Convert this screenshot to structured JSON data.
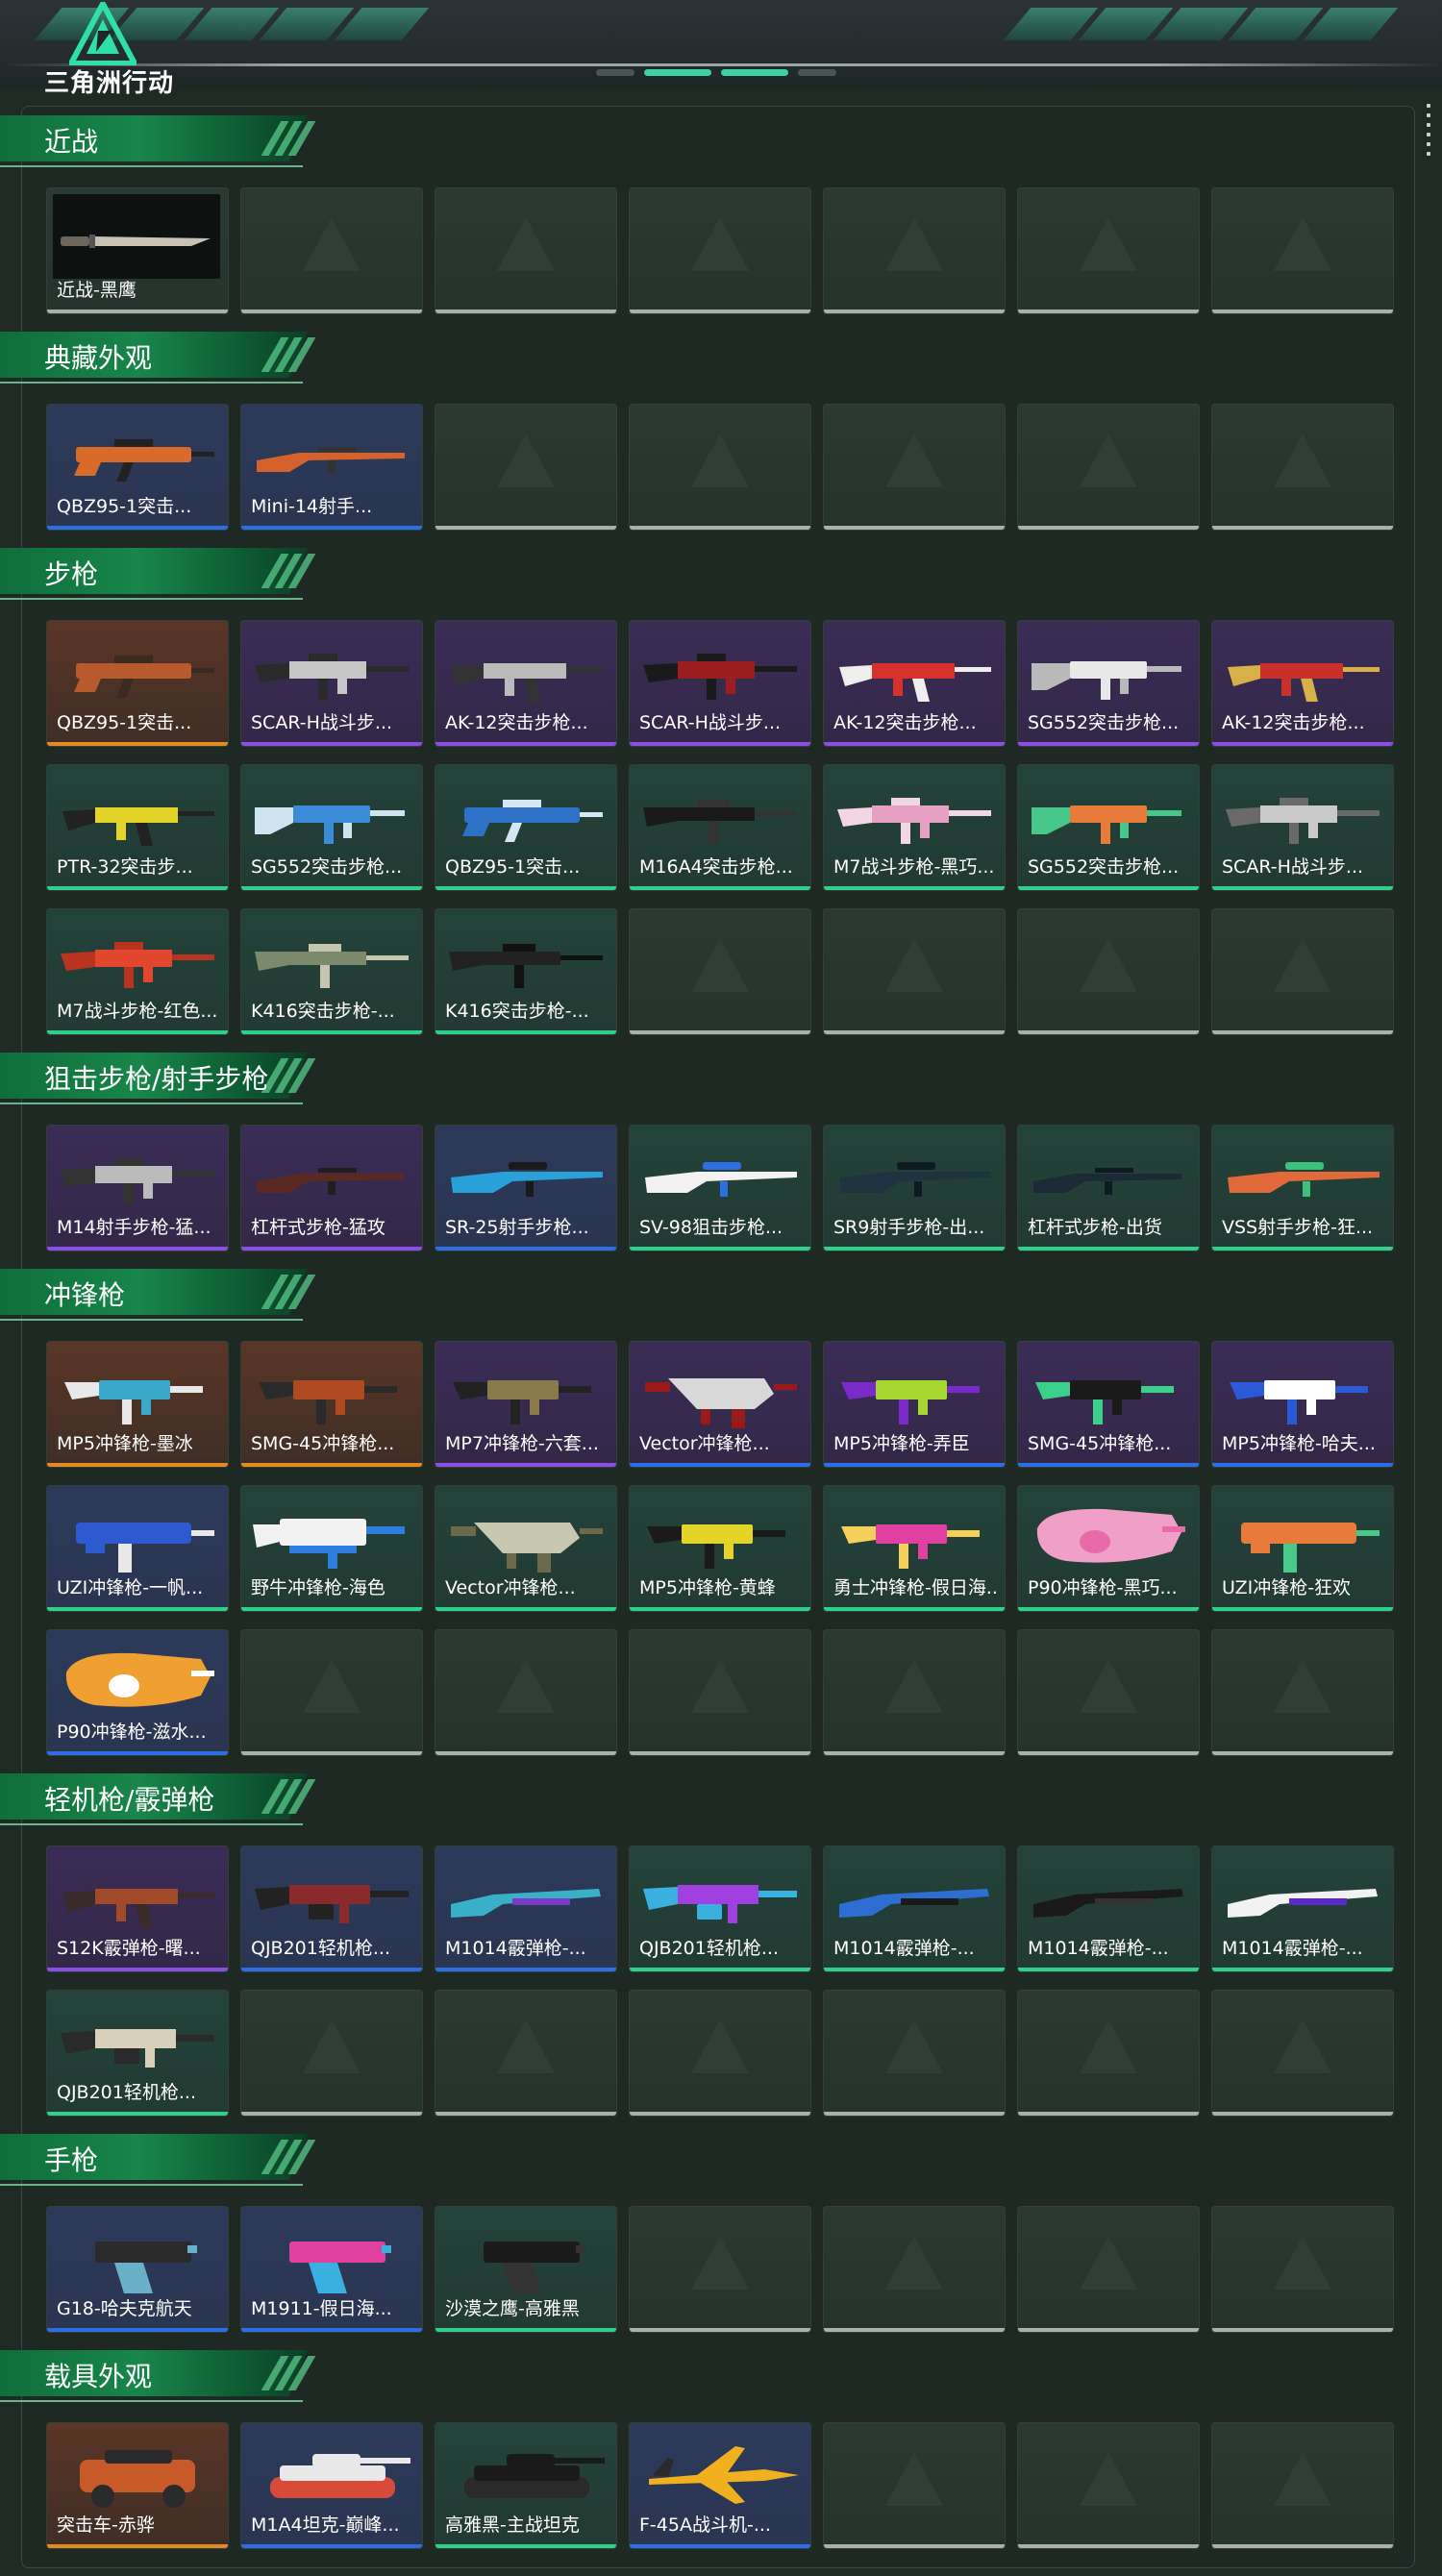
{
  "logo": {
    "text": "三角洲行动"
  },
  "sections": [
    {
      "title": "近战",
      "items": [
        {
          "name": "近战-黑鹰",
          "rarity": "gray",
          "bg": "dark",
          "art": "knife",
          "colors": [
            "#c9c1b3",
            "#6e655b"
          ]
        }
      ]
    },
    {
      "title": "典藏外观",
      "items": [
        {
          "name": "QBZ95-1突击...",
          "rarity": "blue",
          "bg": "blue",
          "art": "bullpup",
          "colors": [
            "#d86a2a",
            "#222"
          ]
        },
        {
          "name": "Mini-14射手...",
          "rarity": "blue",
          "bg": "blue",
          "art": "rifle",
          "colors": [
            "#d4622a",
            "#333"
          ]
        }
      ]
    },
    {
      "title": "步枪",
      "items": [
        {
          "name": "QBZ95-1突击...",
          "rarity": "orange",
          "bg": "orange",
          "art": "bullpup",
          "colors": [
            "#b85a2e",
            "#3a2a22"
          ]
        },
        {
          "name": "SCAR-H战斗步...",
          "rarity": "purple",
          "bg": "purple",
          "art": "scar",
          "colors": [
            "#c6c6c6",
            "#2a2a2a"
          ]
        },
        {
          "name": "AK-12突击步枪...",
          "rarity": "purple",
          "bg": "purple",
          "art": "ak",
          "colors": [
            "#bbbbbb",
            "#333"
          ]
        },
        {
          "name": "SCAR-H战斗步...",
          "rarity": "purple",
          "bg": "purple",
          "art": "scar",
          "colors": [
            "#9b1d1d",
            "#1a1a1a"
          ]
        },
        {
          "name": "AK-12突击步枪...",
          "rarity": "purple",
          "bg": "purple",
          "art": "ak",
          "colors": [
            "#d8302a",
            "#eeeeee"
          ]
        },
        {
          "name": "SG552突击步枪...",
          "rarity": "purple",
          "bg": "purple",
          "art": "sg",
          "colors": [
            "#e8e8e8",
            "#b9b9b9"
          ]
        },
        {
          "name": "AK-12突击步枪...",
          "rarity": "purple",
          "bg": "purple",
          "art": "ak",
          "colors": [
            "#c9302a",
            "#d8b04a"
          ]
        },
        {
          "name": "PTR-32突击步...",
          "rarity": "green",
          "bg": "green",
          "art": "ak",
          "colors": [
            "#e4d428",
            "#222"
          ]
        },
        {
          "name": "SG552突击步枪...",
          "rarity": "green",
          "bg": "green",
          "art": "sg",
          "colors": [
            "#3b8bd8",
            "#d0e4f0"
          ]
        },
        {
          "name": "QBZ95-1突击...",
          "rarity": "green",
          "bg": "green",
          "art": "bullpup",
          "colors": [
            "#2e72c8",
            "#d6e6f4"
          ]
        },
        {
          "name": "M16A4突击步枪...",
          "rarity": "green",
          "bg": "green",
          "art": "m16",
          "colors": [
            "#1a1a1a",
            "#333"
          ]
        },
        {
          "name": "M7战斗步枪-黑巧...",
          "rarity": "green",
          "bg": "green",
          "art": "scar",
          "colors": [
            "#e6a0c4",
            "#f3d6e4"
          ]
        },
        {
          "name": "SG552突击步枪...",
          "rarity": "green",
          "bg": "green",
          "art": "sg",
          "colors": [
            "#e87a3a",
            "#47c88a"
          ]
        },
        {
          "name": "SCAR-H战斗步...",
          "rarity": "green",
          "bg": "green",
          "art": "scar",
          "colors": [
            "#c9c9c9",
            "#6a6a6a"
          ]
        },
        {
          "name": "M7战斗步枪-红色...",
          "rarity": "green",
          "bg": "green",
          "art": "scar",
          "colors": [
            "#e2472e",
            "#b83320"
          ]
        },
        {
          "name": "K416突击步枪-...",
          "rarity": "green",
          "bg": "green",
          "art": "m16",
          "colors": [
            "#7a8a6a",
            "#c6c6b0"
          ]
        },
        {
          "name": "K416突击步枪-...",
          "rarity": "green",
          "bg": "green",
          "art": "m16",
          "colors": [
            "#222",
            "#111"
          ]
        }
      ]
    },
    {
      "title": "狙击步枪/射手步枪",
      "items": [
        {
          "name": "M14射手步枪-猛...",
          "rarity": "purple",
          "bg": "purple",
          "art": "scar",
          "colors": [
            "#bbbbbb",
            "#333"
          ]
        },
        {
          "name": "杠杆式步枪-猛攻",
          "rarity": "purple",
          "bg": "purple",
          "art": "rifle",
          "colors": [
            "#5a2a22",
            "#1f1f1f"
          ]
        },
        {
          "name": "SR-25射手步枪...",
          "rarity": "blue",
          "bg": "blue",
          "art": "sniper",
          "colors": [
            "#2aa0d8",
            "#1a1a1a"
          ]
        },
        {
          "name": "SV-98狙击步枪...",
          "rarity": "green",
          "bg": "green",
          "art": "sniper",
          "colors": [
            "#f2f2f2",
            "#2e6ee0"
          ]
        },
        {
          "name": "SR9射手步枪-出...",
          "rarity": "green",
          "bg": "green",
          "art": "sniper",
          "colors": [
            "#1e3340",
            "#0e1a22"
          ]
        },
        {
          "name": "杠杆式步枪-出货",
          "rarity": "green",
          "bg": "green",
          "art": "rifle",
          "colors": [
            "#1a2a36",
            "#0f1a22"
          ]
        },
        {
          "name": "VSS射手步枪-狂...",
          "rarity": "green",
          "bg": "green",
          "art": "sniper",
          "colors": [
            "#e26a3a",
            "#3cc27a"
          ]
        }
      ]
    },
    {
      "title": "冲锋枪",
      "items": [
        {
          "name": "MP5冲锋枪-墨冰",
          "rarity": "orange",
          "bg": "orange",
          "art": "smg",
          "colors": [
            "#3aa8c8",
            "#e8e8e8"
          ]
        },
        {
          "name": "SMG-45冲锋枪...",
          "rarity": "orange",
          "bg": "orange",
          "art": "smg",
          "colors": [
            "#b04a22",
            "#2a2a2a"
          ]
        },
        {
          "name": "MP7冲锋枪-六套...",
          "rarity": "purple",
          "bg": "purple",
          "art": "smg",
          "colors": [
            "#8a7a4a",
            "#222"
          ]
        },
        {
          "name": "Vector冲锋枪...",
          "rarity": "blue",
          "bg": "purple",
          "art": "vector",
          "colors": [
            "#d8d8d8",
            "#9a1a1a"
          ]
        },
        {
          "name": "MP5冲锋枪-弄臣",
          "rarity": "blue",
          "bg": "purple",
          "art": "smg",
          "colors": [
            "#a8d830",
            "#7a2ac8"
          ]
        },
        {
          "name": "SMG-45冲锋枪...",
          "rarity": "blue",
          "bg": "purple",
          "art": "smg",
          "colors": [
            "#1a1a1a",
            "#3ad08a"
          ]
        },
        {
          "name": "MP5冲锋枪-哈夫...",
          "rarity": "blue",
          "bg": "purple",
          "art": "smg",
          "colors": [
            "#ffffff",
            "#2a5ad8"
          ]
        },
        {
          "name": "UZI冲锋枪-一帆...",
          "rarity": "green",
          "bg": "blue",
          "art": "uzi",
          "colors": [
            "#2e5ad0",
            "#e8e8e8"
          ]
        },
        {
          "name": "野牛冲锋枪-海色",
          "rarity": "green",
          "bg": "green",
          "art": "bizon",
          "colors": [
            "#f2f2f2",
            "#2e7ee0"
          ]
        },
        {
          "name": "Vector冲锋枪...",
          "rarity": "green",
          "bg": "green",
          "art": "vector",
          "colors": [
            "#c8c8b0",
            "#6a6a4a"
          ]
        },
        {
          "name": "MP5冲锋枪-黄蜂",
          "rarity": "green",
          "bg": "green",
          "art": "smg",
          "colors": [
            "#e4d428",
            "#1a1a1a"
          ]
        },
        {
          "name": "勇士冲锋枪-假日海...",
          "rarity": "green",
          "bg": "green",
          "art": "smg",
          "colors": [
            "#e040a0",
            "#f4d05a"
          ]
        },
        {
          "name": "P90冲锋枪-黑巧...",
          "rarity": "green",
          "bg": "green",
          "art": "p90",
          "colors": [
            "#f0a0c8",
            "#e86aa8"
          ]
        },
        {
          "name": "UZI冲锋枪-狂欢",
          "rarity": "green",
          "bg": "green",
          "art": "uzi",
          "colors": [
            "#e87a3a",
            "#4ac88a"
          ]
        },
        {
          "name": "P90冲锋枪-滋水...",
          "rarity": "blue",
          "bg": "blue",
          "art": "p90",
          "colors": [
            "#f0a030",
            "#ffffff"
          ]
        }
      ]
    },
    {
      "title": "轻机枪/霰弹枪",
      "items": [
        {
          "name": "S12K霰弹枪-曙...",
          "rarity": "purple",
          "bg": "purple",
          "art": "ak",
          "colors": [
            "#a04a2a",
            "#3a2a2a"
          ]
        },
        {
          "name": "QJB201轻机枪...",
          "rarity": "blue",
          "bg": "blue",
          "art": "lmg",
          "colors": [
            "#8a2a2a",
            "#222"
          ]
        },
        {
          "name": "M1014霰弹枪-...",
          "rarity": "blue",
          "bg": "blue",
          "art": "shotgun",
          "colors": [
            "#3ab0c8",
            "#7a3ac8"
          ]
        },
        {
          "name": "QJB201轻机枪...",
          "rarity": "green",
          "bg": "green",
          "art": "lmg",
          "colors": [
            "#a040e0",
            "#3ab0e0"
          ]
        },
        {
          "name": "M1014霰弹枪-...",
          "rarity": "green",
          "bg": "green",
          "art": "shotgun",
          "colors": [
            "#2e6ed0",
            "#1a1a1a"
          ]
        },
        {
          "name": "M1014霰弹枪-...",
          "rarity": "green",
          "bg": "green",
          "art": "shotgun",
          "colors": [
            "#1a1a1a",
            "#333"
          ]
        },
        {
          "name": "M1014霰弹枪-...",
          "rarity": "green",
          "bg": "green",
          "art": "shotgun",
          "colors": [
            "#f2f2f2",
            "#5a2ac8"
          ]
        },
        {
          "name": "QJB201轻机枪...",
          "rarity": "green",
          "bg": "green",
          "art": "lmg",
          "colors": [
            "#d8d0b8",
            "#2a2a2a"
          ]
        }
      ]
    },
    {
      "title": "手枪",
      "items": [
        {
          "name": "G18-哈夫克航天",
          "rarity": "blue",
          "bg": "blue",
          "art": "pistol",
          "colors": [
            "#2a2a2a",
            "#6ab0c8"
          ]
        },
        {
          "name": "M1911-假日海...",
          "rarity": "blue",
          "bg": "blue",
          "art": "pistol",
          "colors": [
            "#e040a0",
            "#3ab0e0"
          ]
        },
        {
          "name": "沙漠之鹰-高雅黑",
          "rarity": "green",
          "bg": "green",
          "art": "pistol",
          "colors": [
            "#1a1a1a",
            "#333"
          ]
        }
      ]
    },
    {
      "title": "载具外观",
      "items": [
        {
          "name": "突击车-赤骅",
          "rarity": "orange",
          "bg": "orange",
          "art": "car",
          "colors": [
            "#c85a2a",
            "#2a2a2a"
          ]
        },
        {
          "name": "M1A4坦克-巅峰...",
          "rarity": "blue",
          "bg": "blue",
          "art": "tank",
          "colors": [
            "#e8e8e8",
            "#d84a3a"
          ]
        },
        {
          "name": "高雅黑-主战坦克",
          "rarity": "green",
          "bg": "green",
          "art": "tank",
          "colors": [
            "#1a1a1a",
            "#2a2a2a"
          ]
        },
        {
          "name": "F-45A战斗机-...",
          "rarity": "blue",
          "bg": "blue",
          "art": "jet",
          "colors": [
            "#f0b020",
            "#2a2a2a"
          ]
        }
      ]
    }
  ]
}
